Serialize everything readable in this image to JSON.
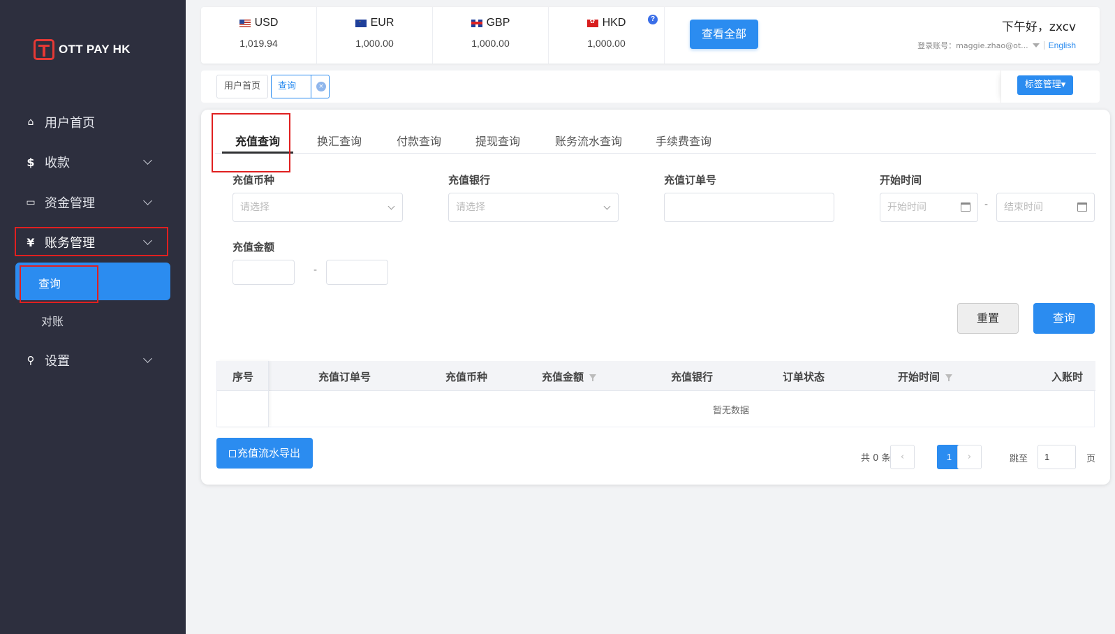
{
  "brand": {
    "name": "OTT PAY HK",
    "accent": "#2b8cf0",
    "sidebar_bg": "#2d2f3e",
    "highlight": "#e02020"
  },
  "sidebar": {
    "items": [
      {
        "label": "用户首页",
        "icon": "home-icon"
      },
      {
        "label": "收款",
        "icon": "dollar-icon"
      },
      {
        "label": "资金管理",
        "icon": "card-icon"
      },
      {
        "label": "账务管理",
        "icon": "yen-icon"
      },
      {
        "label": "设置",
        "icon": "search-icon"
      }
    ],
    "submenu": [
      {
        "label": "查询"
      },
      {
        "label": "对账"
      }
    ]
  },
  "currencies": [
    {
      "code": "USD",
      "amount": "1,019.94",
      "flag": "us-flag-icon"
    },
    {
      "code": "EUR",
      "amount": "1,000.00",
      "flag": "eu-flag-icon"
    },
    {
      "code": "GBP",
      "amount": "1,000.00",
      "flag": "gb-flag-icon"
    },
    {
      "code": "HKD",
      "amount": "1,000.00",
      "flag": "hk-flag-icon"
    }
  ],
  "header": {
    "help_glyph": "?",
    "view_all": "查看全部",
    "greeting": "下午好，zxcv",
    "account_label": "登录账号：maggie.zhao@ot...",
    "language": "English"
  },
  "tagbar": {
    "tags": [
      {
        "label": "用户首页"
      },
      {
        "label": "查询"
      }
    ],
    "close_glyph": "×",
    "manage": "标签管理▾"
  },
  "tabs": [
    "充值查询",
    "换汇查询",
    "付款查询",
    "提现查询",
    "账务流水查询",
    "手续费查询"
  ],
  "filters": {
    "currency_label": "充值币种",
    "currency_placeholder": "请选择",
    "bank_label": "充值银行",
    "bank_placeholder": "请选择",
    "order_label": "充值订单号",
    "order_value": "",
    "time_label": "开始时间",
    "start_placeholder": "开始时间",
    "end_placeholder": "结束时间",
    "range_sep": "-",
    "amount_label": "充值金额",
    "amount_min": "",
    "amount_max": ""
  },
  "actions": {
    "reset": "重置",
    "query": "查询",
    "export": "充值流水导出"
  },
  "table": {
    "columns": [
      "序号",
      "充值订单号",
      "充值币种",
      "充值金额",
      "充值银行",
      "订单状态",
      "开始时间",
      "入账时"
    ],
    "empty": "暂无数据"
  },
  "pagination": {
    "total": "共 0 条",
    "prev": "‹",
    "next": "›",
    "current": "1",
    "jump_label": "跳至",
    "jump_value": "1",
    "unit": "页"
  }
}
